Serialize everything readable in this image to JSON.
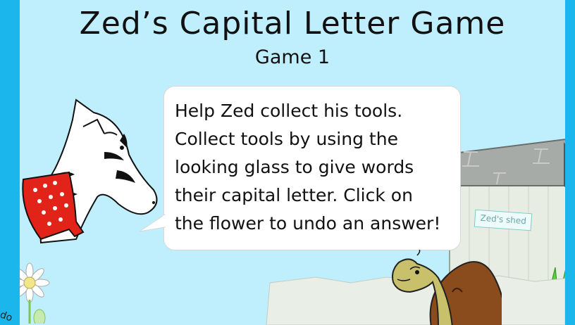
{
  "game": {
    "title": "Zed’s Capital Letter Game",
    "subtitle": "Game 1"
  },
  "speech_bubble": {
    "lines": [
      "Help Zed collect his tools.",
      "Collect tools by using the",
      "looking glass to give words",
      "their capital letter. Click on",
      "the flower to undo an answer!"
    ]
  },
  "shed": {
    "sign": "Zed's shed"
  },
  "flower": {
    "partial_label": "do"
  },
  "colors": {
    "border_blue": "#1ab6ec",
    "sky": "#bfeffc",
    "shed_wood": "#e9eee6",
    "scarf_red": "#e2231a",
    "tortoise_shell": "#8a4b1d",
    "tortoise_skin": "#c9c06b"
  },
  "icons": {
    "character": "zebra-zed",
    "tortoise": "tortoise",
    "flower": "daisy-flower-undo"
  }
}
